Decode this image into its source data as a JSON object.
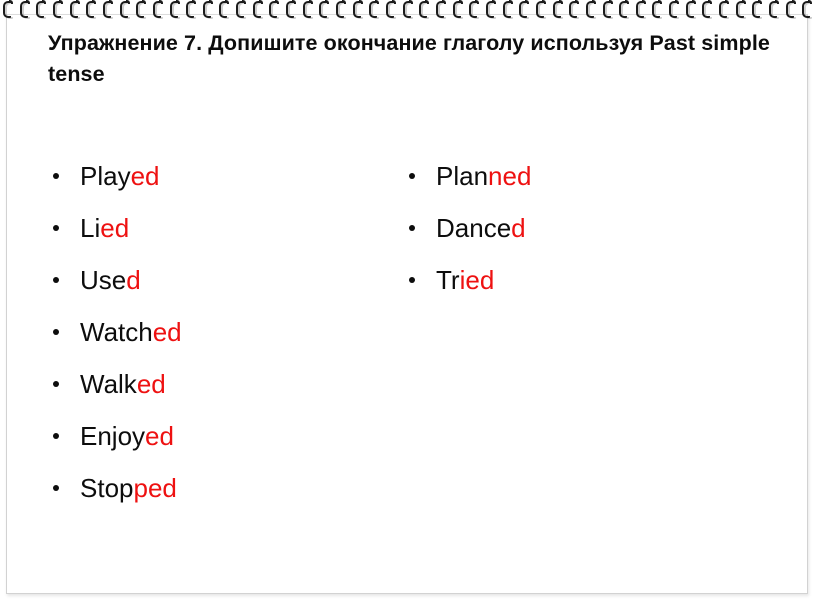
{
  "slide": {
    "title": "Упражнение 7. Допишите окончание глаголу используя Past simple tense",
    "background_color": "#ffffff",
    "sheet_border_color": "#d2d2d2",
    "stem_color": "#0d0d0d",
    "ending_color": "#ee1111",
    "spiral_ring_color": "#1c1c1c",
    "spiral_ring_count": 49,
    "bullet_icon": "bullet-dot-icon"
  },
  "columns": {
    "left": {
      "items": [
        {
          "stem": "Play",
          "ending": "ed"
        },
        {
          "stem": "Li",
          "ending": "ed"
        },
        {
          "stem": "Use",
          "ending": "d"
        },
        {
          "stem": "Watch",
          "ending": "ed"
        },
        {
          "stem": "Walk",
          "ending": "ed"
        },
        {
          "stem": "Enjoy",
          "ending": "ed"
        },
        {
          "stem": "Stop",
          "ending": "ped"
        }
      ]
    },
    "right": {
      "items": [
        {
          "stem": "Plan",
          "ending": "ned"
        },
        {
          "stem": "Dance",
          "ending": "d"
        },
        {
          "stem": "Tr",
          "ending": "ied"
        }
      ]
    }
  }
}
